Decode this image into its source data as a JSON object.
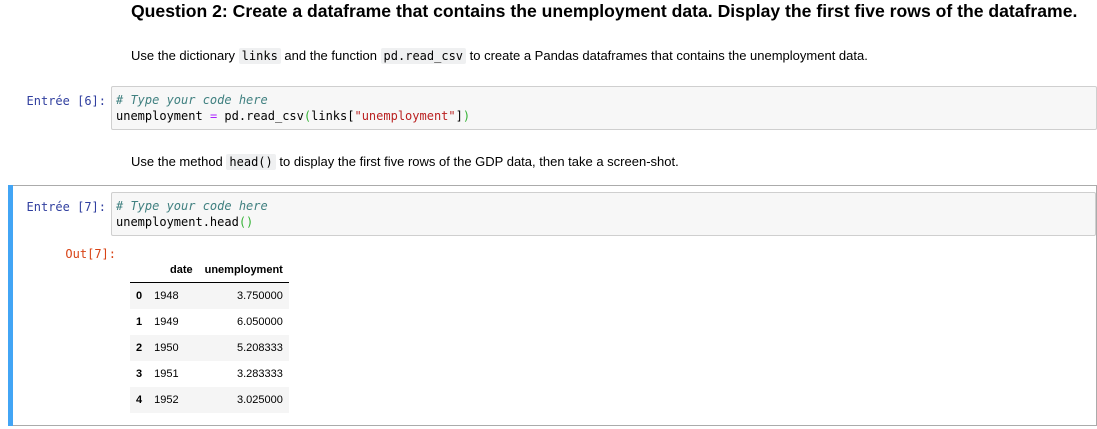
{
  "heading": "Question 2: Create a dataframe that contains the unemployment data. Display the first five rows of the dataframe.",
  "md1": {
    "t1": "Use the dictionary ",
    "code1": "links",
    "t2": " and the function ",
    "code2": "pd.read_csv",
    "t3": " to create a Pandas dataframes that contains the unemployment data."
  },
  "cell6": {
    "prompt": "Entrée [6]:",
    "comment": "# Type your code here",
    "var": "unemployment",
    "op": "=",
    "call": "pd.read_csv",
    "open_paren": "(",
    "obj": "links",
    "open_bracket": "[",
    "key": "\"unemployment\"",
    "close_bracket": "]",
    "close_paren": ")"
  },
  "md2": {
    "t1": "Use the method ",
    "code1": "head()",
    "t2": " to display the first five rows of the GDP data, then take a screen-shot."
  },
  "cell7": {
    "prompt": "Entrée [7]:",
    "comment": "# Type your code here",
    "call": "unemployment.head",
    "parens": "()",
    "out_prompt": "Out[7]:"
  },
  "table": {
    "columns": [
      "",
      "date",
      "unemployment"
    ],
    "rows": [
      {
        "index": "0",
        "date": "1948",
        "unemployment": "3.750000"
      },
      {
        "index": "1",
        "date": "1949",
        "unemployment": "6.050000"
      },
      {
        "index": "2",
        "date": "1950",
        "unemployment": "5.208333"
      },
      {
        "index": "3",
        "date": "1951",
        "unemployment": "3.283333"
      },
      {
        "index": "4",
        "date": "1952",
        "unemployment": "3.025000"
      }
    ]
  },
  "colors": {
    "selected_bar": "#42a5f5",
    "in_prompt": "#303f9f",
    "out_prompt": "#d84315"
  }
}
